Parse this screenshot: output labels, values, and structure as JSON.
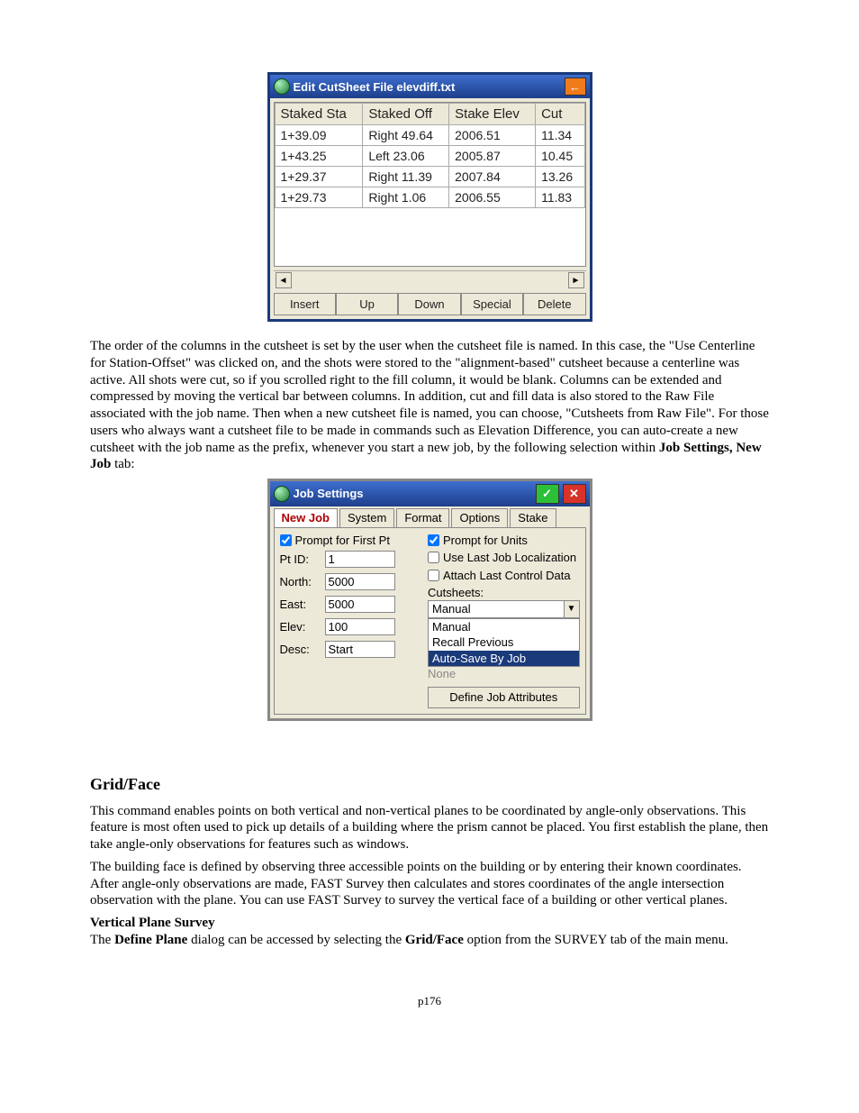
{
  "cutsheet": {
    "title": "Edit CutSheet File  elevdiff.txt",
    "back_glyph": "←",
    "columns": [
      "Staked Sta",
      "Staked Off",
      "Stake Elev",
      "Cut"
    ],
    "rows": [
      {
        "c0": "1+39.09",
        "c1": "Right 49.64",
        "c2": "2006.51",
        "c3": "11.34"
      },
      {
        "c0": "1+43.25",
        "c1": "Left 23.06",
        "c2": "2005.87",
        "c3": "10.45"
      },
      {
        "c0": "1+29.37",
        "c1": "Right 11.39",
        "c2": "2007.84",
        "c3": "13.26"
      },
      {
        "c0": "1+29.73",
        "c1": "Right 1.06",
        "c2": "2006.55",
        "c3": "11.83"
      }
    ],
    "buttons": [
      "Insert",
      "Up",
      "Down",
      "Special",
      "Delete"
    ],
    "scroll_left": "◄",
    "scroll_right": "►"
  },
  "para1_a": "The order of the columns in the cutsheet is set by the user when the cutsheet file is named.  In this case, the \"Use Centerline for Station-Offset\" was clicked on, and the shots were stored to the \"alignment-based\" cutsheet because a centerline was active.  All shots were cut, so if you scrolled right to the fill column, it would be blank. Columns can be extended and compressed by moving the vertical bar between columns.   In addition, cut and fill data is also stored to the Raw File associated with the job name.  Then when a new cutsheet file is named, you can choose, \"Cutsheets from Raw File\".  For those users who always want a cutsheet file to be made in commands such as Elevation Difference, you can auto-create a new cutsheet with the job name as the prefix, whenever you start a new job, by the following selection within ",
  "para1_b": "Job Settings, New Job",
  "para1_c": " tab:",
  "jobsettings": {
    "title": "Job Settings",
    "ok_glyph": "✓",
    "cancel_glyph": "✕",
    "tabs": [
      "New Job",
      "System",
      "Format",
      "Options",
      "Stake"
    ],
    "chk_first_pt": "Prompt for First Pt",
    "chk_units": "Prompt for Units",
    "chk_localization": "Use Last Job Localization",
    "chk_attach": "Attach Last Control Data",
    "lbl_ptid": "Pt ID:",
    "val_ptid": "1",
    "lbl_north": "North:",
    "val_north": "5000",
    "lbl_east": "East:",
    "val_east": "5000",
    "lbl_elev": "Elev:",
    "val_elev": "100",
    "lbl_desc": "Desc:",
    "val_desc": "Start",
    "lbl_cutsheets": "Cutsheets:",
    "dd_selected": "Manual",
    "dd_options": [
      "Manual",
      "Recall Previous",
      "Auto-Save By Job"
    ],
    "dd_selected_idx": 2,
    "none_label": "None",
    "btn_attrs": "Define Job Attributes",
    "dd_arrow": "▼"
  },
  "section_heading": "Grid/Face",
  "para2": "This command enables points on both vertical and non-vertical planes to be coordinated by angle-only observations. This feature is most often used to pick up details of a building where the prism cannot be placed.  You first establish the plane, then take angle-only observations for features such as windows.",
  "para3": "The building face is defined by observing three accessible points on the building or by entering their known coordinates. After angle-only observations are made, FAST Survey then calculates and stores coordinates of the angle intersection observation with the plane.  You can use FAST Survey to survey the vertical face of a building or other vertical planes.",
  "subheading": "Vertical Plane Survey",
  "para4_a": "The ",
  "para4_b": "Define Plane",
  "para4_c": " dialog can be accessed by selecting the ",
  "para4_d": "Grid/Face",
  "para4_e": " option from the SURVEY tab of the main menu.",
  "page_number": "p176"
}
